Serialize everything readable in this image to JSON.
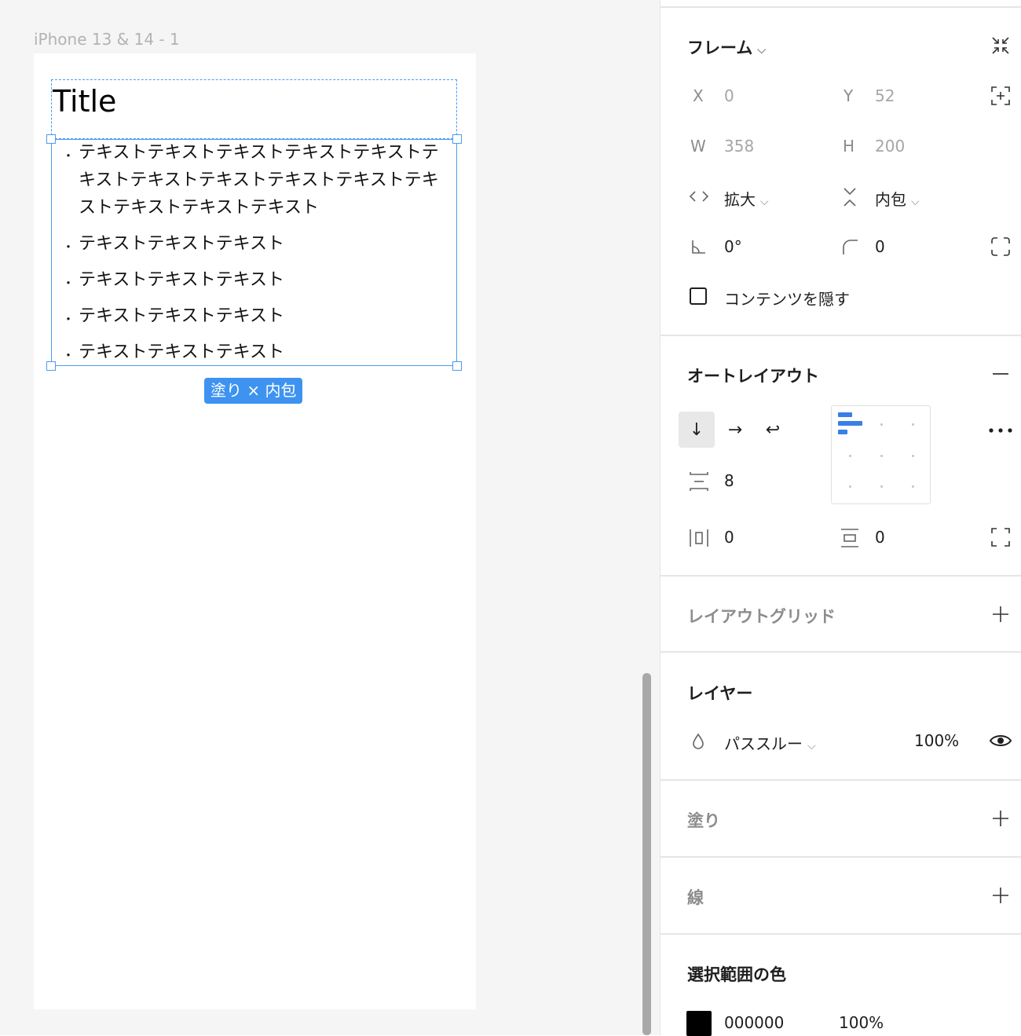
{
  "canvas": {
    "frame_name": "iPhone 13 & 14 - 1",
    "title": "Title",
    "bullet_symbol": "・",
    "bullets": [
      "テキストテキストテキストテキストテキストテキストテキストテキストテキストテキストテキストテキストテキストテキスト",
      "テキストテキストテキスト",
      "テキストテキストテキスト",
      "テキストテキストテキスト",
      "テキストテキストテキスト"
    ],
    "size_badge": "塗り × 内包"
  },
  "panel": {
    "frame": {
      "title": "フレーム",
      "x_label": "X",
      "x_value": "0",
      "y_label": "Y",
      "y_value": "52",
      "w_label": "W",
      "w_value": "358",
      "h_label": "H",
      "h_value": "200",
      "horizontal_resizing": "拡大",
      "vertical_resizing": "内包",
      "rotation": "0°",
      "corner_radius": "0",
      "clip_content_label": "コンテンツを隠す"
    },
    "auto_layout": {
      "title": "オートレイアウト",
      "direction": "vertical",
      "gap": "8",
      "horizontal_padding": "0",
      "vertical_padding": "0"
    },
    "layout_grid": {
      "title": "レイアウトグリッド"
    },
    "layer": {
      "title": "レイヤー",
      "blend_mode": "パススルー",
      "opacity": "100%"
    },
    "fill": {
      "title": "塗り"
    },
    "stroke": {
      "title": "線"
    },
    "selection_colors": {
      "title": "選択範囲の色",
      "hex": "000000",
      "opacity": "100%",
      "swatch_color": "#000000"
    }
  },
  "accent_color": "#4a9cf0"
}
